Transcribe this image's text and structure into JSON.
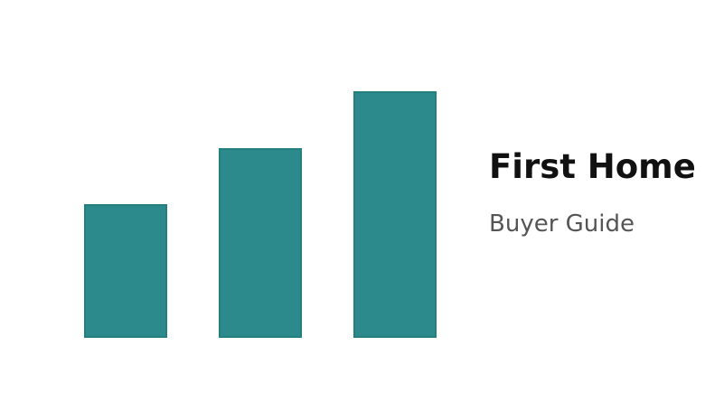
{
  "logo": {
    "title": "First Home",
    "subtitle": "Buyer Guide",
    "colors": {
      "bar_fill": "#2c8a8c",
      "bar_border": "#24807f",
      "title": "#111111",
      "subtitle": "#555555"
    },
    "bars_ascending": [
      1,
      2,
      3
    ]
  }
}
